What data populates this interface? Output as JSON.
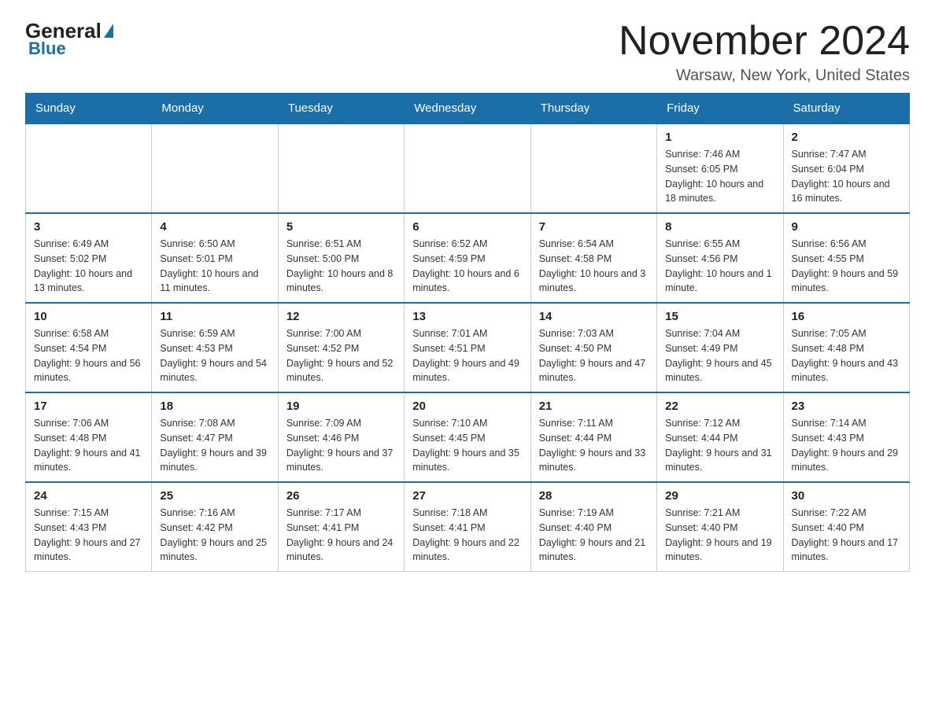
{
  "logo": {
    "text_general": "General",
    "triangle": "▶",
    "text_blue": "Blue"
  },
  "header": {
    "month_title": "November 2024",
    "location": "Warsaw, New York, United States"
  },
  "weekdays": [
    "Sunday",
    "Monday",
    "Tuesday",
    "Wednesday",
    "Thursday",
    "Friday",
    "Saturday"
  ],
  "weeks": [
    [
      {
        "day": "",
        "info": ""
      },
      {
        "day": "",
        "info": ""
      },
      {
        "day": "",
        "info": ""
      },
      {
        "day": "",
        "info": ""
      },
      {
        "day": "",
        "info": ""
      },
      {
        "day": "1",
        "info": "Sunrise: 7:46 AM\nSunset: 6:05 PM\nDaylight: 10 hours and 18 minutes."
      },
      {
        "day": "2",
        "info": "Sunrise: 7:47 AM\nSunset: 6:04 PM\nDaylight: 10 hours and 16 minutes."
      }
    ],
    [
      {
        "day": "3",
        "info": "Sunrise: 6:49 AM\nSunset: 5:02 PM\nDaylight: 10 hours and 13 minutes."
      },
      {
        "day": "4",
        "info": "Sunrise: 6:50 AM\nSunset: 5:01 PM\nDaylight: 10 hours and 11 minutes."
      },
      {
        "day": "5",
        "info": "Sunrise: 6:51 AM\nSunset: 5:00 PM\nDaylight: 10 hours and 8 minutes."
      },
      {
        "day": "6",
        "info": "Sunrise: 6:52 AM\nSunset: 4:59 PM\nDaylight: 10 hours and 6 minutes."
      },
      {
        "day": "7",
        "info": "Sunrise: 6:54 AM\nSunset: 4:58 PM\nDaylight: 10 hours and 3 minutes."
      },
      {
        "day": "8",
        "info": "Sunrise: 6:55 AM\nSunset: 4:56 PM\nDaylight: 10 hours and 1 minute."
      },
      {
        "day": "9",
        "info": "Sunrise: 6:56 AM\nSunset: 4:55 PM\nDaylight: 9 hours and 59 minutes."
      }
    ],
    [
      {
        "day": "10",
        "info": "Sunrise: 6:58 AM\nSunset: 4:54 PM\nDaylight: 9 hours and 56 minutes."
      },
      {
        "day": "11",
        "info": "Sunrise: 6:59 AM\nSunset: 4:53 PM\nDaylight: 9 hours and 54 minutes."
      },
      {
        "day": "12",
        "info": "Sunrise: 7:00 AM\nSunset: 4:52 PM\nDaylight: 9 hours and 52 minutes."
      },
      {
        "day": "13",
        "info": "Sunrise: 7:01 AM\nSunset: 4:51 PM\nDaylight: 9 hours and 49 minutes."
      },
      {
        "day": "14",
        "info": "Sunrise: 7:03 AM\nSunset: 4:50 PM\nDaylight: 9 hours and 47 minutes."
      },
      {
        "day": "15",
        "info": "Sunrise: 7:04 AM\nSunset: 4:49 PM\nDaylight: 9 hours and 45 minutes."
      },
      {
        "day": "16",
        "info": "Sunrise: 7:05 AM\nSunset: 4:48 PM\nDaylight: 9 hours and 43 minutes."
      }
    ],
    [
      {
        "day": "17",
        "info": "Sunrise: 7:06 AM\nSunset: 4:48 PM\nDaylight: 9 hours and 41 minutes."
      },
      {
        "day": "18",
        "info": "Sunrise: 7:08 AM\nSunset: 4:47 PM\nDaylight: 9 hours and 39 minutes."
      },
      {
        "day": "19",
        "info": "Sunrise: 7:09 AM\nSunset: 4:46 PM\nDaylight: 9 hours and 37 minutes."
      },
      {
        "day": "20",
        "info": "Sunrise: 7:10 AM\nSunset: 4:45 PM\nDaylight: 9 hours and 35 minutes."
      },
      {
        "day": "21",
        "info": "Sunrise: 7:11 AM\nSunset: 4:44 PM\nDaylight: 9 hours and 33 minutes."
      },
      {
        "day": "22",
        "info": "Sunrise: 7:12 AM\nSunset: 4:44 PM\nDaylight: 9 hours and 31 minutes."
      },
      {
        "day": "23",
        "info": "Sunrise: 7:14 AM\nSunset: 4:43 PM\nDaylight: 9 hours and 29 minutes."
      }
    ],
    [
      {
        "day": "24",
        "info": "Sunrise: 7:15 AM\nSunset: 4:43 PM\nDaylight: 9 hours and 27 minutes."
      },
      {
        "day": "25",
        "info": "Sunrise: 7:16 AM\nSunset: 4:42 PM\nDaylight: 9 hours and 25 minutes."
      },
      {
        "day": "26",
        "info": "Sunrise: 7:17 AM\nSunset: 4:41 PM\nDaylight: 9 hours and 24 minutes."
      },
      {
        "day": "27",
        "info": "Sunrise: 7:18 AM\nSunset: 4:41 PM\nDaylight: 9 hours and 22 minutes."
      },
      {
        "day": "28",
        "info": "Sunrise: 7:19 AM\nSunset: 4:40 PM\nDaylight: 9 hours and 21 minutes."
      },
      {
        "day": "29",
        "info": "Sunrise: 7:21 AM\nSunset: 4:40 PM\nDaylight: 9 hours and 19 minutes."
      },
      {
        "day": "30",
        "info": "Sunrise: 7:22 AM\nSunset: 4:40 PM\nDaylight: 9 hours and 17 minutes."
      }
    ]
  ]
}
